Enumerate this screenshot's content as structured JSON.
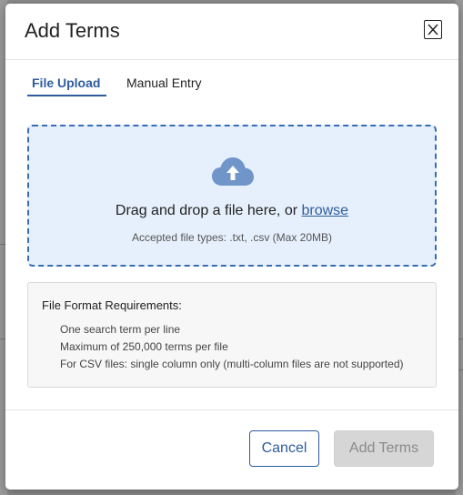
{
  "modal": {
    "title": "Add Terms",
    "close_icon": "close-icon"
  },
  "tabs": [
    {
      "label": "File Upload",
      "active": true
    },
    {
      "label": "Manual Entry",
      "active": false
    }
  ],
  "dropzone": {
    "icon": "cloud-upload-icon",
    "prompt_text": "Drag and drop a file here, or ",
    "browse_label": "browse",
    "accepted_text": "Accepted file types: .txt, .csv (Max 20MB)"
  },
  "requirements": {
    "title": "File Format Requirements:",
    "items": [
      "One search term per line",
      "Maximum of 250,000 terms per file",
      "For CSV files: single column only (multi-column files are not supported)"
    ]
  },
  "footer": {
    "cancel_label": "Cancel",
    "add_label": "Add Terms",
    "add_disabled": true
  },
  "colors": {
    "accent": "#2e5c9e",
    "dropzone_bg": "#e6f0fc",
    "disabled_button_bg": "#d6d6d6"
  }
}
